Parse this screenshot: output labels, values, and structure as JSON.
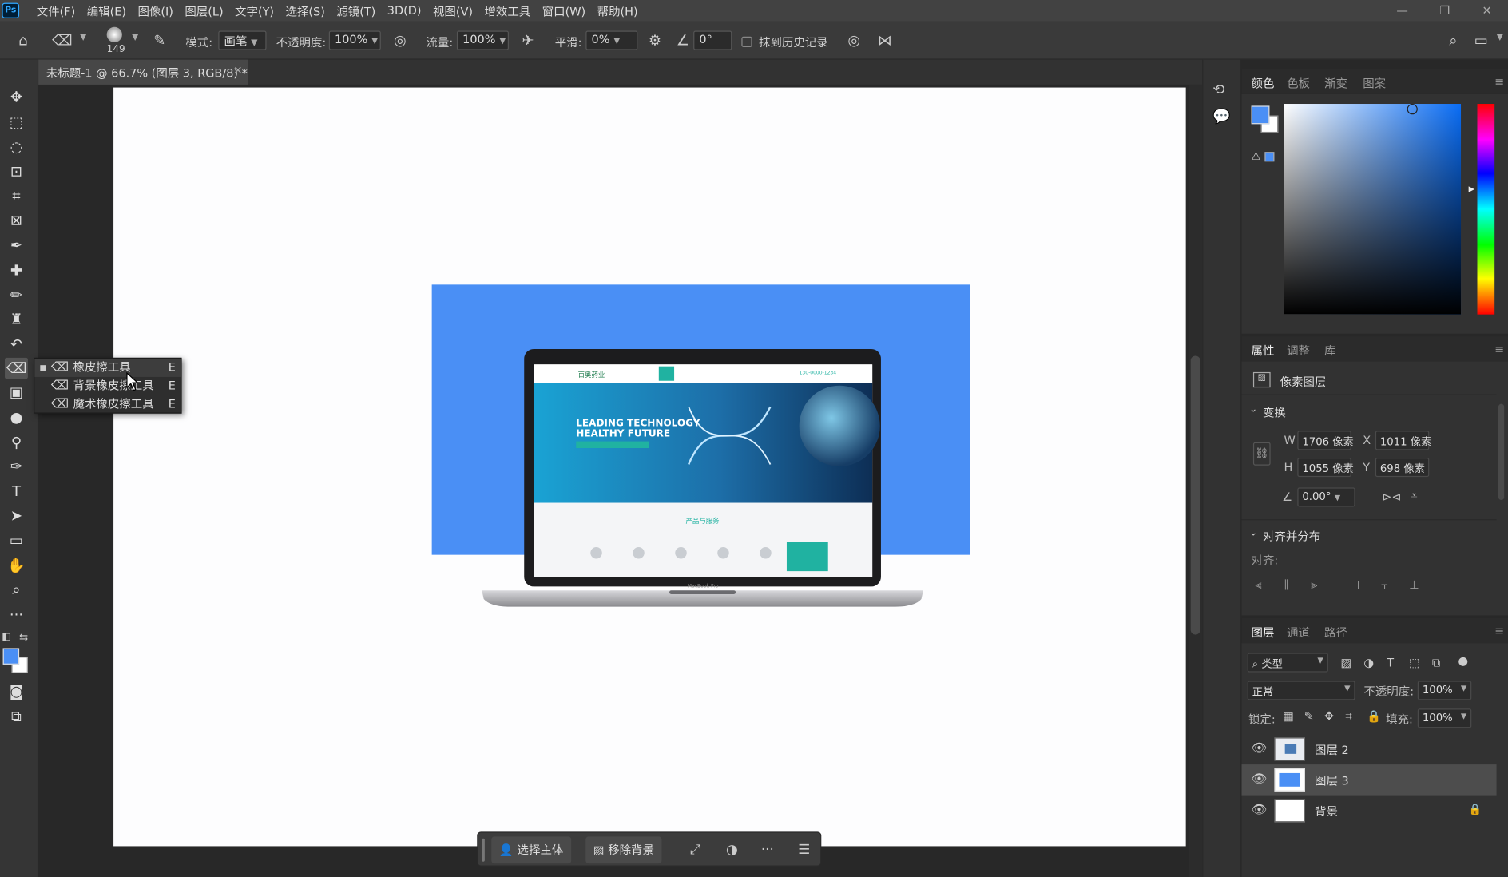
{
  "menubar": {
    "logo": "Ps",
    "items": [
      "文件(F)",
      "编辑(E)",
      "图像(I)",
      "图层(L)",
      "文字(Y)",
      "选择(S)",
      "滤镜(T)",
      "3D(D)",
      "视图(V)",
      "增效工具",
      "窗口(W)",
      "帮助(H)"
    ]
  },
  "options": {
    "brush_size": "149",
    "mode_label": "模式:",
    "mode_value": "画笔",
    "opacity_label": "不透明度:",
    "opacity_value": "100%",
    "flow_label": "流量:",
    "flow_value": "100%",
    "smooth_label": "平滑:",
    "smooth_value": "0%",
    "angle_value": "0°",
    "history_label": "抹到历史记录"
  },
  "document": {
    "tab_title": "未标题-1 @ 66.7% (图层 3, RGB/8) *"
  },
  "flyout": {
    "items": [
      {
        "label": "橡皮擦工具",
        "key": "E"
      },
      {
        "label": "背景橡皮擦工具",
        "key": "E"
      },
      {
        "label": "魔术橡皮擦工具",
        "key": "E"
      }
    ]
  },
  "laptop": {
    "brand": "百奥药业",
    "phone": "130-0000-1234",
    "hero_line1": "LEADING TECHNOLOGY",
    "hero_line2": "HEALTHY FUTURE",
    "section_title": "产品与服务",
    "model": "MacBook Pro"
  },
  "contextbar": {
    "select_subject": "选择主体",
    "remove_bg": "移除背景"
  },
  "color_panel": {
    "tabs": [
      "颜色",
      "色板",
      "渐变",
      "图案"
    ],
    "fg_color": "#4a8ff5",
    "bg_color": "#ffffff"
  },
  "properties": {
    "tabs": [
      "属性",
      "调整",
      "库"
    ],
    "layer_type": "像素图层",
    "transform_label": "变换",
    "w_label": "W",
    "w_value": "1706 像素",
    "x_label": "X",
    "x_value": "1011 像素",
    "h_label": "H",
    "h_value": "1055 像素",
    "y_label": "Y",
    "y_value": "698 像素",
    "angle_value": "0.00°",
    "align_section": "对齐并分布",
    "align_label": "对齐:"
  },
  "layers": {
    "tabs": [
      "图层",
      "通道",
      "路径"
    ],
    "filter": "类型",
    "blend": "正常",
    "opacity_label": "不透明度:",
    "opacity_value": "100%",
    "lock_label": "锁定:",
    "fill_label": "填充:",
    "fill_value": "100%",
    "items": [
      {
        "name": "图层 2"
      },
      {
        "name": "图层 3"
      },
      {
        "name": "背景"
      }
    ]
  }
}
